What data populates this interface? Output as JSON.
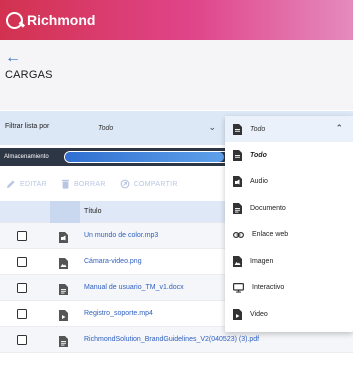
{
  "app": {
    "name": "Richmond"
  },
  "header": {
    "back_icon": "arrow-left-icon",
    "title": "CARGAS"
  },
  "filter": {
    "label": "Filtrar lista por",
    "selected": "Todo"
  },
  "storage": {
    "label": "Almacenamiento",
    "used_fraction": 0.97
  },
  "actions": [
    {
      "label": "EDITAR",
      "icon": "pencil-icon"
    },
    {
      "label": "BORRAR",
      "icon": "trash-icon"
    },
    {
      "label": "COMPARTIR",
      "icon": "share-icon"
    }
  ],
  "table": {
    "title_header": "Título",
    "rows": [
      {
        "name": "Un mundo de color.mp3",
        "icon": "audio-file-icon"
      },
      {
        "name": "Cámara-video.png",
        "icon": "image-file-icon"
      },
      {
        "name": "Manual de usuario_TM_v1.docx",
        "icon": "document-file-icon"
      },
      {
        "name": "Registro_soporte.mp4",
        "icon": "video-file-icon"
      },
      {
        "name": "RichmondSolution_BrandGuidelines_V2(040523) (3).pdf",
        "icon": "document-file-icon"
      }
    ]
  },
  "dropdown": {
    "selected": "Todo",
    "options": [
      {
        "label": "Todo",
        "icon": "document-icon"
      },
      {
        "label": "Audio",
        "icon": "audio-icon"
      },
      {
        "label": "Documento",
        "icon": "document-icon"
      },
      {
        "label": "Enlace web",
        "icon": "link-icon"
      },
      {
        "label": "Imagen",
        "icon": "image-icon"
      },
      {
        "label": "Interactivo",
        "icon": "monitor-icon"
      },
      {
        "label": "Video",
        "icon": "video-icon"
      }
    ]
  },
  "colors": {
    "brand": "#d2324f",
    "accent": "#3b71c6",
    "link": "#2f5fbf"
  }
}
